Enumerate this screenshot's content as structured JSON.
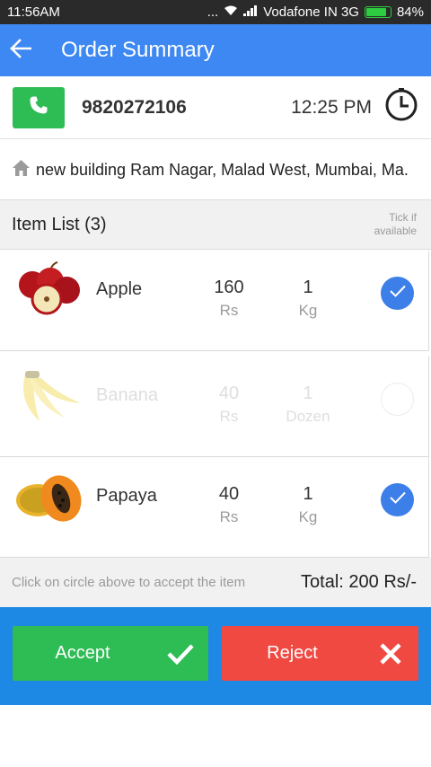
{
  "status_bar": {
    "time": "11:56AM",
    "dots": "...",
    "carrier": "Vodafone IN 3G",
    "battery": "84%",
    "battery_level": 0.84
  },
  "app_bar": {
    "title": "Order Summary",
    "back_icon": "arrow-left-icon",
    "color": "#3d88f2"
  },
  "order": {
    "phone": "9820272106",
    "time": "12:25 PM",
    "address": "new building Ram Nagar, Malad West, Mumbai, Ma."
  },
  "list": {
    "title": "Item List (3)",
    "tick_hint_line1": "Tick if",
    "tick_hint_line2": "available"
  },
  "items": [
    {
      "name": "Apple",
      "price": "160",
      "price_unit": "Rs",
      "qty": "1",
      "qty_unit": "Kg",
      "available": true,
      "image": "apple-image"
    },
    {
      "name": "Banana",
      "price": "40",
      "price_unit": "Rs",
      "qty": "1",
      "qty_unit": "Dozen",
      "available": false,
      "image": "banana-image"
    },
    {
      "name": "Papaya",
      "price": "40",
      "price_unit": "Rs",
      "qty": "1",
      "qty_unit": "Kg",
      "available": true,
      "image": "papaya-image"
    }
  ],
  "footer": {
    "hint": "Click on circle above to accept the item",
    "total": "Total: 200 Rs/-"
  },
  "actions": {
    "accept": "Accept",
    "reject": "Reject",
    "accept_color": "#2ebc55",
    "reject_color": "#ef4942"
  }
}
